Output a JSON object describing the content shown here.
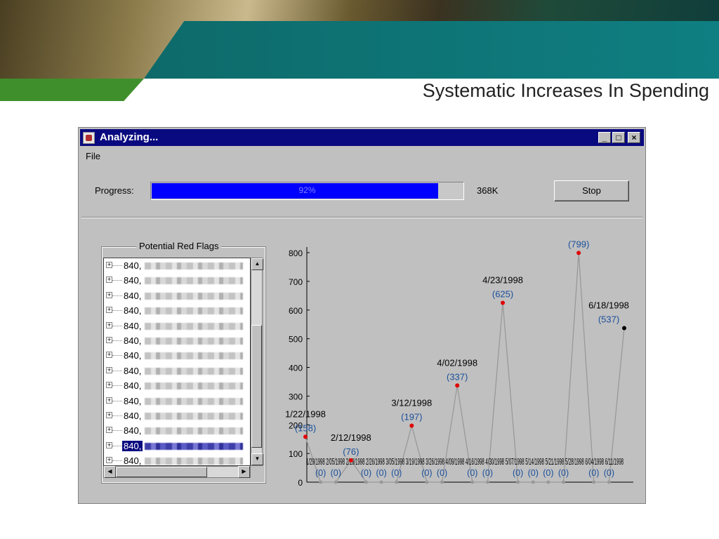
{
  "slide": {
    "title": "Systematic Increases In Spending"
  },
  "window": {
    "title": "Analyzing...",
    "controls": {
      "minimize": "_",
      "maximize": "□",
      "close": "×"
    },
    "menu": [
      "File"
    ]
  },
  "progress": {
    "label": "Progress:",
    "value": 0.92,
    "text": "92%",
    "size": "368K",
    "stop_label": "Stop"
  },
  "panel": {
    "title": "Potential Red Flags",
    "items": [
      {
        "prefix": "840,"
      },
      {
        "prefix": "840,"
      },
      {
        "prefix": "840,"
      },
      {
        "prefix": "840,"
      },
      {
        "prefix": "840,"
      },
      {
        "prefix": "840,"
      },
      {
        "prefix": "840,"
      },
      {
        "prefix": "840,"
      },
      {
        "prefix": "840,"
      },
      {
        "prefix": "840,"
      },
      {
        "prefix": "840,"
      },
      {
        "prefix": "840,"
      },
      {
        "prefix": "840,",
        "selected": true
      },
      {
        "prefix": "840,"
      }
    ]
  },
  "chart_data": {
    "type": "line",
    "ylim": [
      0,
      800
    ],
    "yticks": [
      0,
      100,
      200,
      300,
      400,
      500,
      600,
      700,
      800
    ],
    "series": [
      {
        "points": [
          {
            "date": "1/22/1998",
            "value": 158
          },
          {
            "value": 0
          },
          {
            "value": 0
          },
          {
            "date": "2/12/1998",
            "value": 76
          },
          {
            "value": 0
          },
          {
            "value": 0
          },
          {
            "value": 0
          },
          {
            "date": "3/12/1998",
            "value": 197
          },
          {
            "value": 0
          },
          {
            "value": 0
          },
          {
            "date": "4/02/1998",
            "value": 337
          },
          {
            "value": 0
          },
          {
            "value": 0
          },
          {
            "date": "4/23/1998",
            "value": 625
          },
          {
            "value": 0
          },
          {
            "value": 0
          },
          {
            "value": 0
          },
          {
            "value": 0
          },
          {
            "value": 799
          },
          {
            "value": 0
          },
          {
            "value": 0
          },
          {
            "date": "6/18/1998",
            "value": 537
          }
        ]
      }
    ],
    "labels": [
      "(158)",
      "(0)",
      "(0)",
      "(76)",
      "(0)",
      "(0)",
      "(0)",
      "(197)",
      "(0)",
      "(0)",
      "(337)",
      "(0)",
      "(0)",
      "(625)",
      "(0)",
      "(0)",
      "(0)",
      "(0)",
      "(799)",
      "(0)",
      "(0)",
      "(537)"
    ],
    "bottom_date_text": "1/29/1998 2/05/1998 2/19/1998 2/26/1998 3/05/1998 3/19/1998 3/26/1998 4/09/1998 4/16/1998 4/30/1998 5/07/1998 5/14/1998 5/21/1998 5/28/1998 6/04/1998 6/11/1998"
  }
}
